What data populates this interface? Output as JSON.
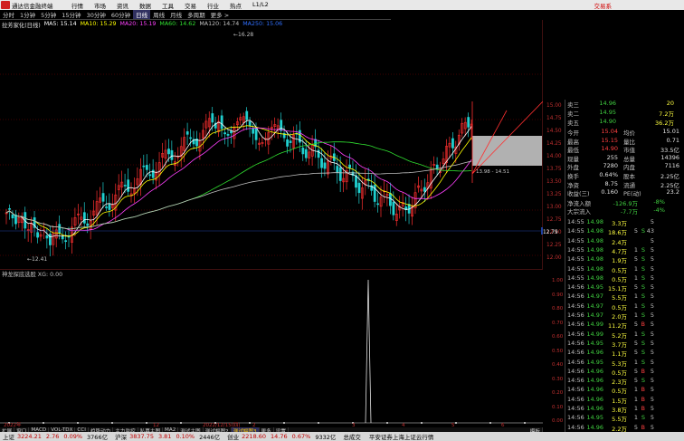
{
  "titlebar": {
    "app_title": "通达信金融终端",
    "menu": [
      "行情",
      "市场",
      "资讯",
      "数据",
      "工具",
      "交易",
      "行业",
      "热点",
      "L1/L2"
    ],
    "trade": "交易系"
  },
  "periods": [
    "分时",
    "1分钟",
    "5分钟",
    "15分钟",
    "30分钟",
    "60分钟",
    "日线",
    "周线",
    "月线",
    "多周期",
    "更多 >"
  ],
  "periods_active": 6,
  "ma_legend": {
    "name": "拉芳家化(日线)",
    "ma5": "MA5: 15.14",
    "ma10": "MA10: 15.29",
    "ma20": "MA20: 15.19",
    "ma60": "MA60: 14.62",
    "ma120": "MA120: 14.74",
    "ma250": "MA250: 15.06"
  },
  "colors": {
    "up": "#ff3030",
    "down": "#20d0d0",
    "ma5": "#ffffff",
    "ma10": "#ffff00",
    "ma20": "#ff40ff",
    "ma60": "#30e030",
    "ma120": "#c0c0c0",
    "ma250": "#3070ff"
  },
  "chart_annot": {
    "high": "16.28",
    "low": "12.41",
    "range": "13.98 - 14.51",
    "current": "12.79"
  },
  "price_axis": [
    "15.00",
    "14.75",
    "14.50",
    "14.25",
    "14.00",
    "13.75",
    "13.50",
    "13.25",
    "13.00",
    "12.75",
    "12.50",
    "12.25",
    "12.00"
  ],
  "indicator": {
    "legend": "神龙探底选股 XG: 0.00",
    "axis": [
      "1.00",
      "0.90",
      "0.80",
      "0.70",
      "0.60",
      "0.50",
      "0.40",
      "0.30",
      "0.20",
      "0.10",
      "0.00"
    ]
  },
  "time_axis": [
    "2022年",
    "",
    "",
    "12",
    "2022/12/15(四)",
    "2",
    "",
    "3",
    "4",
    "5",
    "6"
  ],
  "bottom_tabs": [
    "扩展",
    "窗口",
    "MACD",
    "VOL-TDX",
    "CCI",
    "趋势动力",
    "主力监控",
    "私募主图",
    "MA2",
    "测试主图",
    "测试幅图2",
    "测试幅图3",
    "更多",
    "设置"
  ],
  "bottom_tabs_right": "模板",
  "quote": {
    "asks": [
      {
        "l": "卖三",
        "p": "14.96",
        "v": "20"
      },
      {
        "l": "卖二",
        "p": "14.95",
        "v": "7.2万"
      },
      {
        "l": "卖五",
        "p": "14.90",
        "v": "36.2万"
      }
    ],
    "stats": [
      {
        "l1": "今开",
        "v1": "15.04",
        "l2": "均价",
        "v2": "15.01"
      },
      {
        "l1": "最高",
        "v1": "15.15",
        "l2": "量比",
        "v2": "0.71"
      },
      {
        "l1": "最低",
        "v1": "14.90",
        "l2": "市值",
        "v2": "33.5亿"
      },
      {
        "l1": "现量",
        "v1": "255",
        "l2": "总量",
        "v2": "14396"
      },
      {
        "l1": "外盘",
        "v1": "7280",
        "l2": "内盘",
        "v2": "7116"
      },
      {
        "l1": "换手",
        "v1": "0.64%",
        "l2": "股本",
        "v2": "2.25亿"
      },
      {
        "l1": "净资",
        "v1": "8.75",
        "l2": "流通",
        "v2": "2.25亿"
      },
      {
        "l1": "收益(三)",
        "v1": "0.160",
        "l2": "PE(动)",
        "v2": "23.2"
      }
    ],
    "flow": [
      {
        "l": "净流入额",
        "v": "-126.9万",
        "p": "-8%"
      },
      {
        "l": "大宗流入",
        "v": "-7.7万",
        "p": "-4%"
      }
    ],
    "ticks": [
      {
        "t": "14:55",
        "p": "14.98",
        "v": "3.3万",
        "n": "",
        "b": "",
        "c": "5"
      },
      {
        "t": "14:55",
        "p": "14.98",
        "v": "18.6万",
        "n": "5",
        "b": "S",
        "c": "43"
      },
      {
        "t": "14:55",
        "p": "14.98",
        "v": "2.4万",
        "n": "",
        "b": "",
        "c": "5"
      },
      {
        "t": "14:55",
        "p": "14.98",
        "v": "4.7万",
        "n": "1",
        "b": "S",
        "c": "5"
      },
      {
        "t": "14:55",
        "p": "14.98",
        "v": "1.9万",
        "n": "5",
        "b": "S",
        "c": "5"
      },
      {
        "t": "14:55",
        "p": "14.98",
        "v": "0.5万",
        "n": "1",
        "b": "S",
        "c": "5"
      },
      {
        "t": "14:55",
        "p": "14.98",
        "v": "0.5万",
        "n": "1",
        "b": "S",
        "c": "5"
      },
      {
        "t": "14:56",
        "p": "14.95",
        "v": "15.1万",
        "n": "5",
        "b": "S",
        "c": "5"
      },
      {
        "t": "14:56",
        "p": "14.97",
        "v": "5.5万",
        "n": "1",
        "b": "S",
        "c": "5"
      },
      {
        "t": "14:56",
        "p": "14.97",
        "v": "0.5万",
        "n": "1",
        "b": "S",
        "c": "5"
      },
      {
        "t": "14:56",
        "p": "14.97",
        "v": "2.0万",
        "n": "1",
        "b": "S",
        "c": "5"
      },
      {
        "t": "14:56",
        "p": "14.99",
        "v": "11.2万",
        "n": "5",
        "b": "B",
        "c": "5"
      },
      {
        "t": "14:56",
        "p": "14.99",
        "v": "5.2万",
        "n": "1",
        "b": "S",
        "c": "5"
      },
      {
        "t": "14:56",
        "p": "14.95",
        "v": "3.7万",
        "n": "5",
        "b": "S",
        "c": "5"
      },
      {
        "t": "14:56",
        "p": "14.96",
        "v": "1.1万",
        "n": "5",
        "b": "S",
        "c": "5"
      },
      {
        "t": "14:56",
        "p": "14.95",
        "v": "5.3万",
        "n": "1",
        "b": "S",
        "c": "5"
      },
      {
        "t": "14:56",
        "p": "14.96",
        "v": "0.5万",
        "n": "5",
        "b": "B",
        "c": "5"
      },
      {
        "t": "14:56",
        "p": "14.96",
        "v": "2.3万",
        "n": "5",
        "b": "S",
        "c": "5"
      },
      {
        "t": "14:56",
        "p": "14.96",
        "v": "0.5万",
        "n": "1",
        "b": "B",
        "c": "5"
      },
      {
        "t": "14:56",
        "p": "14.96",
        "v": "1.5万",
        "n": "1",
        "b": "B",
        "c": "5"
      },
      {
        "t": "14:56",
        "p": "14.96",
        "v": "3.8万",
        "n": "1",
        "b": "B",
        "c": "5"
      },
      {
        "t": "14:56",
        "p": "14.95",
        "v": "5.5万",
        "n": "1",
        "b": "S",
        "c": "5"
      },
      {
        "t": "14:56",
        "p": "14.96",
        "v": "2.2万",
        "n": "5",
        "b": "B",
        "c": "5"
      },
      {
        "t": "14:56",
        "p": "14.95",
        "v": "3.3万",
        "n": "5",
        "b": "B",
        "c": "5"
      },
      {
        "t": "14:56",
        "p": "14.95",
        "v": "2.6万",
        "n": "5",
        "b": "B",
        "c": "5"
      }
    ]
  },
  "statusbar": [
    {
      "name": "上证",
      "val": "3224.21",
      "chg": "2.76",
      "pct": "0.09%",
      "vol": "3766亿"
    },
    {
      "name": "沪深",
      "val": "3837.75",
      "chg": "3.81",
      "pct": "0.10%",
      "vol": "2446亿"
    },
    {
      "name": "创业",
      "val": "2218.60",
      "chg": "14.76",
      "pct": "0.67%",
      "vol": "9332亿"
    }
  ],
  "status_extra": "总成交",
  "status_news": "平安证券上海上证云行情",
  "watermark": "www.7gpzb.com"
}
